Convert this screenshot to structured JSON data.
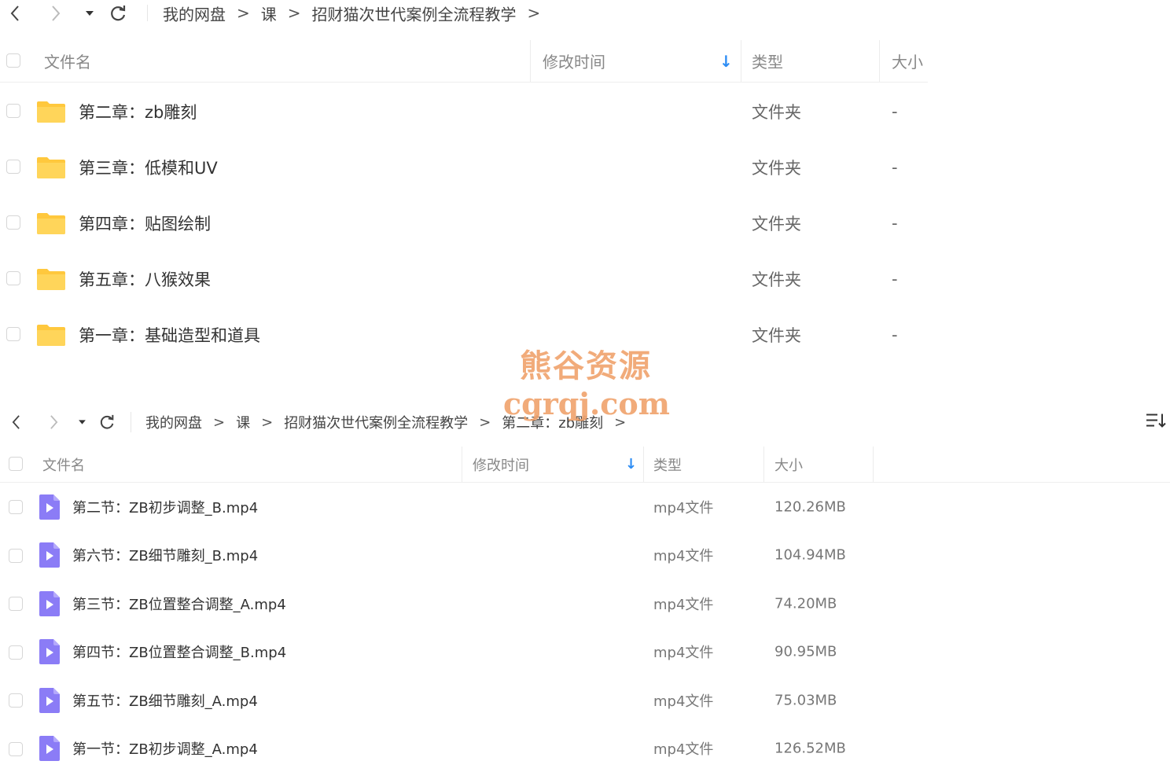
{
  "panel1": {
    "breadcrumb": [
      "我的网盘",
      "课",
      "招财猫次世代案例全流程教学"
    ],
    "sep": ">",
    "headers": {
      "name": "文件名",
      "modified": "修改时间",
      "sort_arrow": "↓",
      "type": "类型",
      "size": "大小"
    },
    "rows": [
      {
        "name": "第二章：zb雕刻",
        "type": "文件夹",
        "size": "-"
      },
      {
        "name": "第三章：低模和UV",
        "type": "文件夹",
        "size": "-"
      },
      {
        "name": "第四章：贴图绘制",
        "type": "文件夹",
        "size": "-"
      },
      {
        "name": "第五章：八猴效果",
        "type": "文件夹",
        "size": "-"
      },
      {
        "name": "第一章：基础造型和道具",
        "type": "文件夹",
        "size": "-"
      }
    ]
  },
  "panel2": {
    "breadcrumb": [
      "我的网盘",
      "课",
      "招财猫次世代案例全流程教学",
      "第二章：zb雕刻"
    ],
    "sep": ">",
    "headers": {
      "name": "文件名",
      "modified": "修改时间",
      "sort_arrow": "↓",
      "type": "类型",
      "size": "大小"
    },
    "sort_menu_icon": "sort-menu-icon",
    "rows": [
      {
        "name": "第二节：ZB初步调整_B.mp4",
        "type": "mp4文件",
        "size": "120.26MB"
      },
      {
        "name": "第六节：ZB细节雕刻_B.mp4",
        "type": "mp4文件",
        "size": "104.94MB"
      },
      {
        "name": "第三节：ZB位置整合调整_A.mp4",
        "type": "mp4文件",
        "size": "74.20MB"
      },
      {
        "name": "第四节：ZB位置整合调整_B.mp4",
        "type": "mp4文件",
        "size": "90.95MB"
      },
      {
        "name": "第五节：ZB细节雕刻_A.mp4",
        "type": "mp4文件",
        "size": "75.03MB"
      },
      {
        "name": "第一节：ZB初步调整_A.mp4",
        "type": "mp4文件",
        "size": "126.52MB"
      }
    ]
  },
  "watermark": {
    "line1": "熊谷资源",
    "line2": "cgrqj.com"
  },
  "colors": {
    "folder": "#ffc83d",
    "video": "#8b7cf6",
    "accent": "#2c8cf4",
    "watermark": "#f0a26c"
  }
}
